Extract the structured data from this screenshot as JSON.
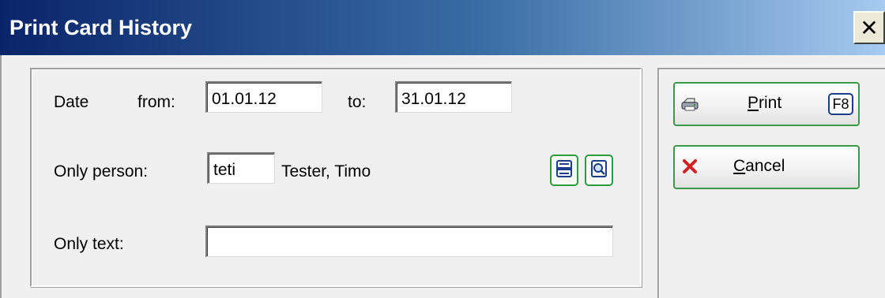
{
  "window": {
    "title": "Print Card History",
    "close_glyph": "✕"
  },
  "form": {
    "date_label": "Date",
    "from_label": "from:",
    "from_value": "01.01.12",
    "to_label": "to:",
    "to_value": "31.01.12",
    "person_label": "Only person:",
    "person_code": "teti",
    "person_name": "Tester, Timo",
    "text_label": "Only text:",
    "text_value": ""
  },
  "buttons": {
    "print": {
      "label_ul": "P",
      "label_rest": "rint",
      "shortcut": "F8",
      "icon": "printer-icon"
    },
    "cancel": {
      "label_ul": "C",
      "label_rest": "ancel",
      "icon": "red-x-icon"
    },
    "person_lookup_icon": "person-list-icon",
    "person_search_icon": "magnifier-icon"
  },
  "colors": {
    "title_gradient_start": "#0a246a",
    "title_gradient_end": "#a6caf0",
    "button_border": "#3a9a48",
    "shortcut_border": "#1c3c8c",
    "cancel_icon": "#d42020"
  }
}
